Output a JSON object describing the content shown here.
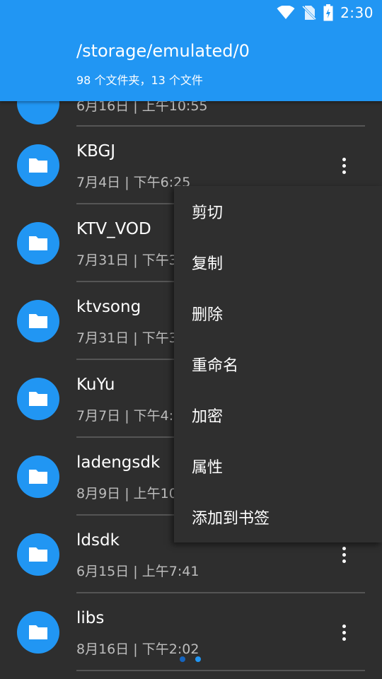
{
  "status_bar": {
    "time": "2:30",
    "icons": [
      "wifi-icon",
      "no-sim-icon",
      "battery-charging-icon"
    ]
  },
  "header": {
    "path": "/storage/emulated/0",
    "summary": "98 个文件夹，13 个文件"
  },
  "colors": {
    "accent": "#2196f3",
    "background": "#2e2e2e",
    "menu": "#2f2f2f"
  },
  "folders": [
    {
      "name": "",
      "meta": "6月16日 | 上午10:55"
    },
    {
      "name": "KBGJ",
      "meta": "7月4日 | 下午6:25"
    },
    {
      "name": "KTV_VOD",
      "meta": "7月31日 | 下午3"
    },
    {
      "name": "ktvsong",
      "meta": "7月31日 | 下午3"
    },
    {
      "name": "KuYu",
      "meta": "7月7日 | 下午4:4"
    },
    {
      "name": "ladengsdk",
      "meta": "8月9日 | 上午10"
    },
    {
      "name": "ldsdk",
      "meta": "6月15日 | 上午7:41"
    },
    {
      "name": "libs",
      "meta": "8月16日 | 下午2:02"
    }
  ],
  "context_menu": {
    "items": [
      "剪切",
      "复制",
      "删除",
      "重命名",
      "加密",
      "属性",
      "添加到书签"
    ]
  },
  "page_indicator": {
    "pages": 2,
    "active": 2
  }
}
